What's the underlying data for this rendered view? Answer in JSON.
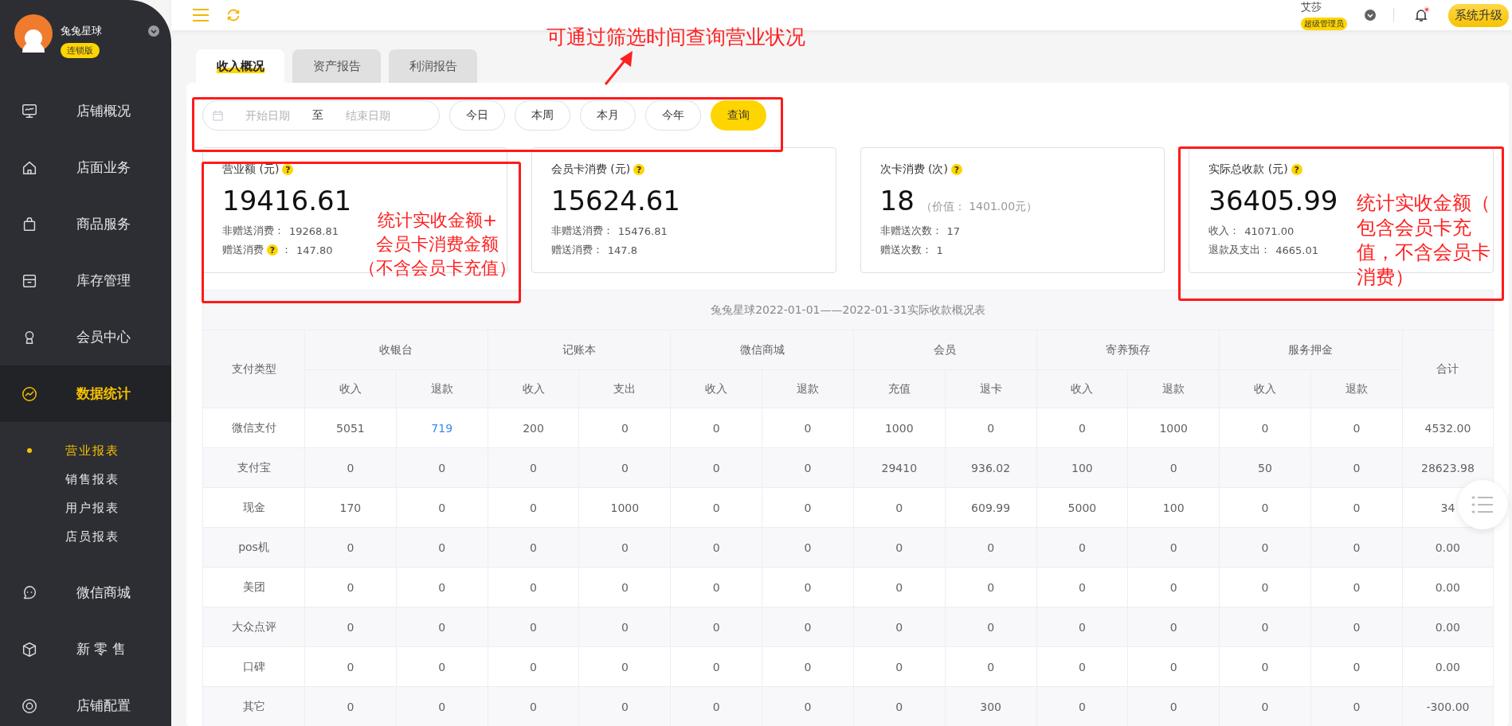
{
  "sidebar": {
    "brand": {
      "name": "兔兔星球",
      "badge": "连锁版"
    },
    "items": [
      {
        "label": "店铺概况",
        "selected": false
      },
      {
        "label": "店面业务",
        "selected": false
      },
      {
        "label": "商品服务",
        "selected": false
      },
      {
        "label": "库存管理",
        "selected": false
      },
      {
        "label": "会员中心",
        "selected": false
      },
      {
        "label": "数据统计",
        "selected": true,
        "children": [
          {
            "label": "营业报表",
            "selected": true
          },
          {
            "label": "销售报表",
            "selected": false
          },
          {
            "label": "用户报表",
            "selected": false
          },
          {
            "label": "店员报表",
            "selected": false
          }
        ]
      },
      {
        "label": "微信商城",
        "selected": false
      },
      {
        "label": "新 零 售",
        "selected": false
      },
      {
        "label": "店铺配置",
        "selected": false
      }
    ]
  },
  "header": {
    "user": {
      "name": "艾莎",
      "role": "超级管理员"
    },
    "unread": true,
    "upgrade_button": "系统升级"
  },
  "tabs": [
    {
      "label": "收入概况",
      "selected": true
    },
    {
      "label": "资产报告",
      "selected": false
    },
    {
      "label": "利润报告",
      "selected": false
    }
  ],
  "filter": {
    "start_placeholder": "开始日期",
    "separator": "至",
    "end_placeholder": "结束日期",
    "quick_buttons": [
      "今日",
      "本周",
      "本月",
      "今年"
    ],
    "query_button": "查询"
  },
  "cards": [
    {
      "title": "营业额 (元)",
      "help": "?",
      "value": "19416.61",
      "details": [
        {
          "label": "非赠送消费：",
          "value": "19268.81"
        },
        {
          "label": "赠送消费",
          "help": "?",
          "suffix": "：",
          "value": "147.80"
        }
      ]
    },
    {
      "title": "会员卡消费 (元)",
      "help": "?",
      "value": "15624.61",
      "details": [
        {
          "label": "非赠送消费：",
          "value": "15476.81"
        },
        {
          "label": "赠送消费：",
          "value": "147.8"
        }
      ]
    },
    {
      "title": "次卡消费 (次)",
      "help": "?",
      "value": "18",
      "note": "（价值： 1401.00元）",
      "details": [
        {
          "label": "非赠送次数：",
          "value": "17"
        },
        {
          "label": "赠送次数：",
          "value": "1"
        }
      ]
    },
    {
      "title": "实际总收款 (元)",
      "help": "?",
      "value": "36405.99",
      "details": [
        {
          "label": "收入：",
          "value": "41071.00"
        },
        {
          "label": "退款及支出：",
          "value": "4665.01"
        }
      ]
    }
  ],
  "table": {
    "title": "兔兔星球2022-01-01——2022-01-31实际收款概况表",
    "first_column": "支付类型",
    "groups": [
      {
        "label": "收银台",
        "sub": [
          "收入",
          "退款"
        ]
      },
      {
        "label": "记账本",
        "sub": [
          "收入",
          "支出"
        ]
      },
      {
        "label": "微信商城",
        "sub": [
          "收入",
          "退款"
        ]
      },
      {
        "label": "会员",
        "sub": [
          "充值",
          "退卡"
        ]
      },
      {
        "label": "寄养预存",
        "sub": [
          "收入",
          "退款"
        ]
      },
      {
        "label": "服务押金",
        "sub": [
          "收入",
          "退款"
        ]
      }
    ],
    "total_column": "合计",
    "rows": [
      {
        "type": "微信支付",
        "cells": [
          {
            "text": "5051",
            "link": false
          },
          {
            "text": "719",
            "link": true
          },
          {
            "text": "200",
            "link": false
          },
          {
            "text": "0",
            "link": false
          },
          {
            "text": "0",
            "link": false
          },
          {
            "text": "0",
            "link": false
          },
          {
            "text": "1000",
            "link": false
          },
          {
            "text": "0",
            "link": false
          },
          {
            "text": "0",
            "link": false
          },
          {
            "text": "1000",
            "link": false
          },
          {
            "text": "0",
            "link": false
          },
          {
            "text": "0",
            "link": false
          },
          {
            "text": "4532.00",
            "link": false
          }
        ]
      },
      {
        "type": "支付宝",
        "cells": [
          {
            "text": "0",
            "link": false
          },
          {
            "text": "0",
            "link": false
          },
          {
            "text": "0",
            "link": false
          },
          {
            "text": "0",
            "link": false
          },
          {
            "text": "0",
            "link": false
          },
          {
            "text": "0",
            "link": false
          },
          {
            "text": "29410",
            "link": false
          },
          {
            "text": "936.02",
            "link": false
          },
          {
            "text": "100",
            "link": false
          },
          {
            "text": "0",
            "link": false
          },
          {
            "text": "50",
            "link": false
          },
          {
            "text": "0",
            "link": false
          },
          {
            "text": "28623.98",
            "link": false
          }
        ]
      },
      {
        "type": "现金",
        "cells": [
          {
            "text": "170",
            "link": false
          },
          {
            "text": "0",
            "link": false
          },
          {
            "text": "0",
            "link": false
          },
          {
            "text": "1000",
            "link": false
          },
          {
            "text": "0",
            "link": false
          },
          {
            "text": "0",
            "link": false
          },
          {
            "text": "0",
            "link": false
          },
          {
            "text": "609.99",
            "link": false
          },
          {
            "text": "5000",
            "link": false
          },
          {
            "text": "100",
            "link": false
          },
          {
            "text": "0",
            "link": false
          },
          {
            "text": "0",
            "link": false
          },
          {
            "text": "34",
            "link": false
          }
        ]
      },
      {
        "type": "pos机",
        "cells": [
          {
            "text": "0",
            "link": false
          },
          {
            "text": "0",
            "link": false
          },
          {
            "text": "0",
            "link": false
          },
          {
            "text": "0",
            "link": false
          },
          {
            "text": "0",
            "link": false
          },
          {
            "text": "0",
            "link": false
          },
          {
            "text": "0",
            "link": false
          },
          {
            "text": "0",
            "link": false
          },
          {
            "text": "0",
            "link": false
          },
          {
            "text": "0",
            "link": false
          },
          {
            "text": "0",
            "link": false
          },
          {
            "text": "0",
            "link": false
          },
          {
            "text": "0.00",
            "link": false
          }
        ]
      },
      {
        "type": "美团",
        "cells": [
          {
            "text": "0",
            "link": false
          },
          {
            "text": "0",
            "link": false
          },
          {
            "text": "0",
            "link": false
          },
          {
            "text": "0",
            "link": false
          },
          {
            "text": "0",
            "link": false
          },
          {
            "text": "0",
            "link": false
          },
          {
            "text": "0",
            "link": false
          },
          {
            "text": "0",
            "link": false
          },
          {
            "text": "0",
            "link": false
          },
          {
            "text": "0",
            "link": false
          },
          {
            "text": "0",
            "link": false
          },
          {
            "text": "0",
            "link": false
          },
          {
            "text": "0.00",
            "link": false
          }
        ]
      },
      {
        "type": "大众点评",
        "cells": [
          {
            "text": "0",
            "link": false
          },
          {
            "text": "0",
            "link": false
          },
          {
            "text": "0",
            "link": false
          },
          {
            "text": "0",
            "link": false
          },
          {
            "text": "0",
            "link": false
          },
          {
            "text": "0",
            "link": false
          },
          {
            "text": "0",
            "link": false
          },
          {
            "text": "0",
            "link": false
          },
          {
            "text": "0",
            "link": false
          },
          {
            "text": "0",
            "link": false
          },
          {
            "text": "0",
            "link": false
          },
          {
            "text": "0",
            "link": false
          },
          {
            "text": "0.00",
            "link": false
          }
        ]
      },
      {
        "type": "口碑",
        "cells": [
          {
            "text": "0",
            "link": false
          },
          {
            "text": "0",
            "link": false
          },
          {
            "text": "0",
            "link": false
          },
          {
            "text": "0",
            "link": false
          },
          {
            "text": "0",
            "link": false
          },
          {
            "text": "0",
            "link": false
          },
          {
            "text": "0",
            "link": false
          },
          {
            "text": "0",
            "link": false
          },
          {
            "text": "0",
            "link": false
          },
          {
            "text": "0",
            "link": false
          },
          {
            "text": "0",
            "link": false
          },
          {
            "text": "0",
            "link": false
          },
          {
            "text": "0.00",
            "link": false
          }
        ]
      },
      {
        "type": "其它",
        "cells": [
          {
            "text": "0",
            "link": false
          },
          {
            "text": "0",
            "link": false
          },
          {
            "text": "0",
            "link": false
          },
          {
            "text": "0",
            "link": false
          },
          {
            "text": "0",
            "link": false
          },
          {
            "text": "0",
            "link": false
          },
          {
            "text": "0",
            "link": false
          },
          {
            "text": "300",
            "link": false
          },
          {
            "text": "0",
            "link": false
          },
          {
            "text": "0",
            "link": false
          },
          {
            "text": "0",
            "link": false
          },
          {
            "text": "0",
            "link": false
          },
          {
            "text": "-300.00",
            "link": false
          }
        ]
      }
    ]
  },
  "annotations": {
    "filter_note": "可通过筛选时间查询营业状况",
    "revenue_note": [
      "统计实收金额+",
      "会员卡消费金额",
      "（不含会员卡充值）"
    ],
    "total_note": [
      "统计实收金额（",
      "包含会员卡充",
      "值，不含会员卡",
      "消费）"
    ]
  }
}
